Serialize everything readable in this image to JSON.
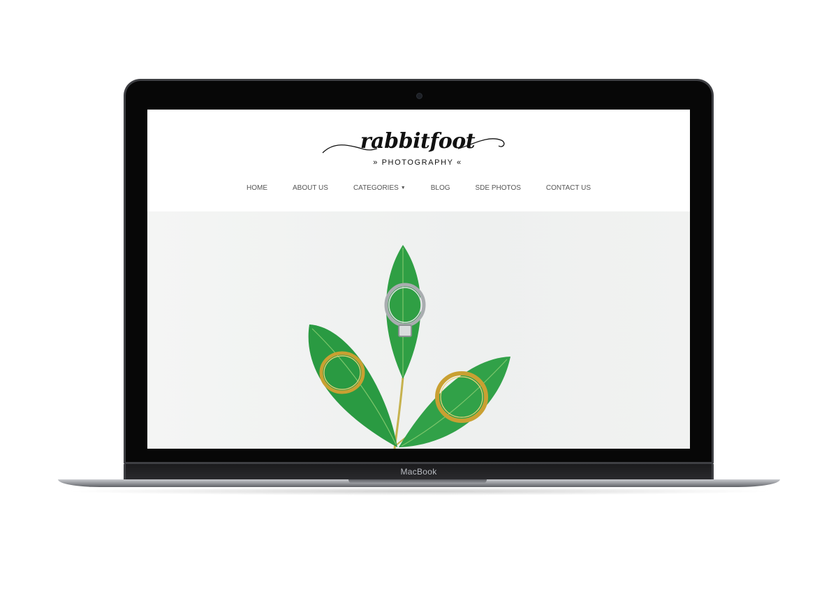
{
  "device": {
    "brand_label": "MacBook"
  },
  "site": {
    "logo": {
      "script": "rabbitfoot",
      "subtitle": "» PHOTOGRAPHY «"
    },
    "nav": [
      {
        "label": "HOME"
      },
      {
        "label": "ABOUT US"
      },
      {
        "label": "CATEGORIES",
        "has_dropdown": true
      },
      {
        "label": "BLOG"
      },
      {
        "label": "SDE PHOTOS"
      },
      {
        "label": "CONTACT US"
      }
    ]
  },
  "hero": {
    "image": "three green leaves with gold wedding rings"
  },
  "colors": {
    "leaf": "#2e9e45",
    "ring_gold": "#d4a93a",
    "ring_silver": "#b9bdc0",
    "nav_text": "#555555"
  }
}
